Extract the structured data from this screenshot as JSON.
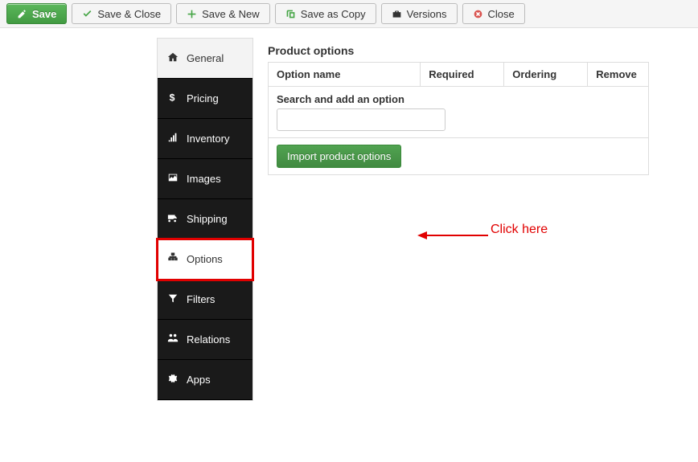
{
  "toolbar": {
    "save": "Save",
    "save_close": "Save & Close",
    "save_new": "Save & New",
    "save_copy": "Save as Copy",
    "versions": "Versions",
    "close": "Close"
  },
  "sidebar": {
    "items": [
      {
        "label": "General"
      },
      {
        "label": "Pricing"
      },
      {
        "label": "Inventory"
      },
      {
        "label": "Images"
      },
      {
        "label": "Shipping"
      },
      {
        "label": "Options"
      },
      {
        "label": "Filters"
      },
      {
        "label": "Relations"
      },
      {
        "label": "Apps"
      }
    ]
  },
  "main": {
    "title": "Product options",
    "columns": {
      "name": "Option name",
      "required": "Required",
      "ordering": "Ordering",
      "remove": "Remove"
    },
    "search_label": "Search and add an option",
    "import_label": "Import product options"
  },
  "callout": "Click here"
}
